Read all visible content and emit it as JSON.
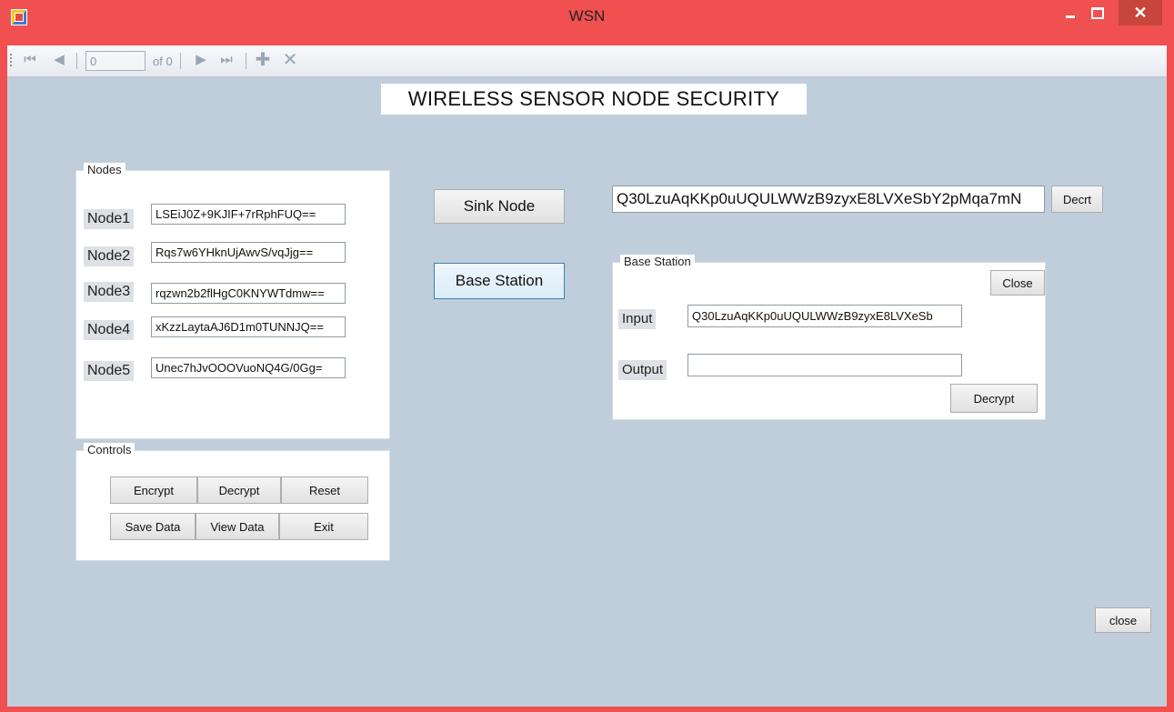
{
  "window": {
    "title": "WSN",
    "close_glyph": "✕"
  },
  "navigator": {
    "position_value": "0",
    "count_text": "of 0"
  },
  "heading": "WIRELESS SENSOR NODE SECURITY",
  "nodes_group": {
    "legend": "Nodes",
    "items": [
      {
        "label": "Node1",
        "value": "LSEiJ0Z+9KJIF+7rRphFUQ=="
      },
      {
        "label": "Node2",
        "value": "Rqs7w6YHknUjAwvS/vqJjg=="
      },
      {
        "label": "Node3",
        "value": "rqzwn2b2flHgC0KNYWTdmw=="
      },
      {
        "label": "Node4",
        "value": "xKzzLaytaAJ6D1m0TUNNJQ=="
      },
      {
        "label": "Node5",
        "value": "Unec7hJvOOOVuoNQ4G/0Gg="
      }
    ]
  },
  "controls_group": {
    "legend": "Controls",
    "encrypt": "Encrypt",
    "decrypt": "Decrypt",
    "reset": "Reset",
    "save_data": "Save Data",
    "view_data": "View Data",
    "exit": "Exit"
  },
  "sink_node_button": "Sink Node",
  "base_station_button": "Base Station",
  "sink_output": {
    "value": "Q30LzuAqKKp0uUQULWWzB9zyxE8LVXeSbY2pMqa7mN",
    "decrypt_button": "Decrt"
  },
  "base_station_group": {
    "legend": "Base Station",
    "close_button": "Close",
    "input_label": "Input",
    "input_value": "Q30LzuAqKKp0uUQULWWzB9zyxE8LVXeSb",
    "output_label": "Output",
    "output_value": "",
    "decrypt_button": "Decrypt"
  },
  "form_close_button": "close"
}
